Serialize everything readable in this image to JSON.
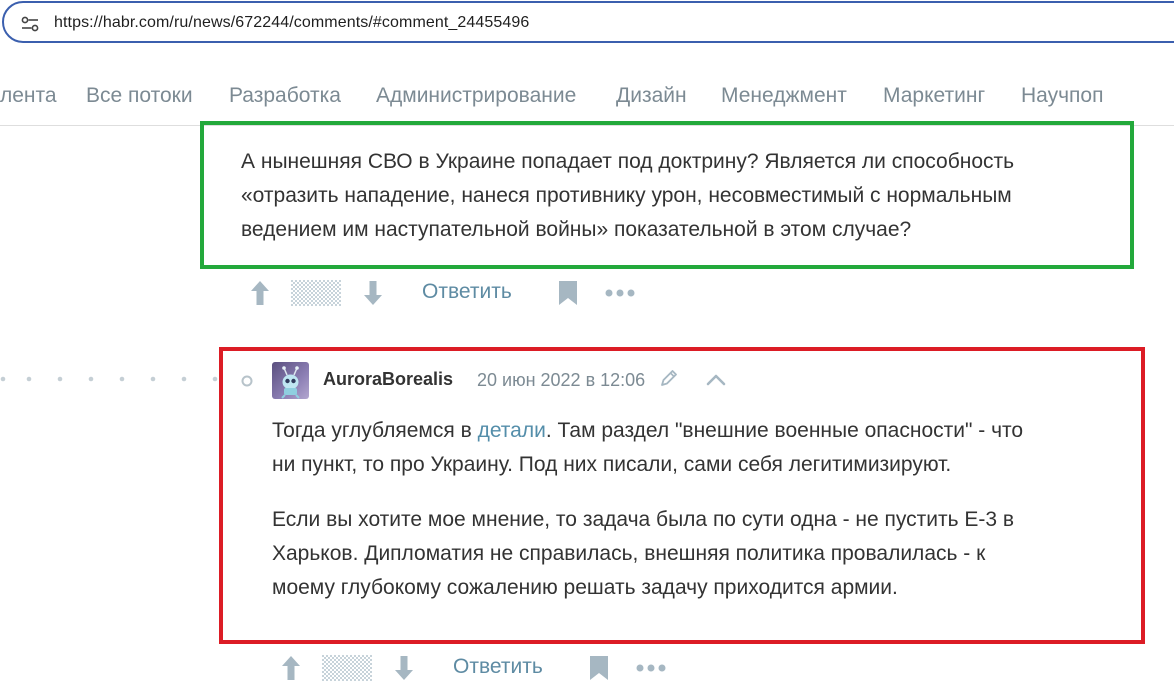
{
  "browser": {
    "url": "https://habr.com/ru/news/672244/comments/#comment_24455496"
  },
  "nav": {
    "items": [
      "лента",
      "Все потоки",
      "Разработка",
      "Администрирование",
      "Дизайн",
      "Менеджмент",
      "Маркетинг",
      "Научпоп"
    ]
  },
  "comment1": {
    "text_lines": [
      "А нынешняя СВО в Украине попадает под доктрину? Является ли способность",
      "«отразить нападение, нанеся противнику урон, несовместимый с нормальным",
      "ведением им наступательной войны» показательной в этом случае?"
    ],
    "reply_label": "Ответить",
    "highlight_color": "#23a93b"
  },
  "comment2": {
    "author": "AuroraBorealis",
    "date": "20 июн 2022 в 12:06",
    "para1_before_link": "Тогда углубляемся в ",
    "para1_link": "детали",
    "para1_after_link_line1": ". Там раздел \"внешние военные опасности\" - что",
    "para1_line2": "ни пункт, то про Украину. Под них писали, сами себя легитимизируют.",
    "para2_lines": [
      "Если вы хотите мое мнение, то задача была по сути одна - не пустить Е-3 в",
      "Харьков. Дипломатия не справилась, внешняя политика провалилась - к",
      "моему глубокому сожалению решать задачу приходится армии."
    ],
    "reply_label": "Ответить",
    "highlight_color": "#dc1c25"
  },
  "icons": {
    "site_info": "tune-icon",
    "upvote": "arrow-up-icon",
    "downvote": "arrow-down-icon",
    "score": "hidden-score-icon",
    "bookmark": "bookmark-icon",
    "more": "more-dots-icon",
    "edit": "pencil-icon",
    "collapse": "chevron-up-icon"
  },
  "colors": {
    "link": "#548eaa",
    "muted": "#7c8a93",
    "icon": "#a6b7c2"
  }
}
